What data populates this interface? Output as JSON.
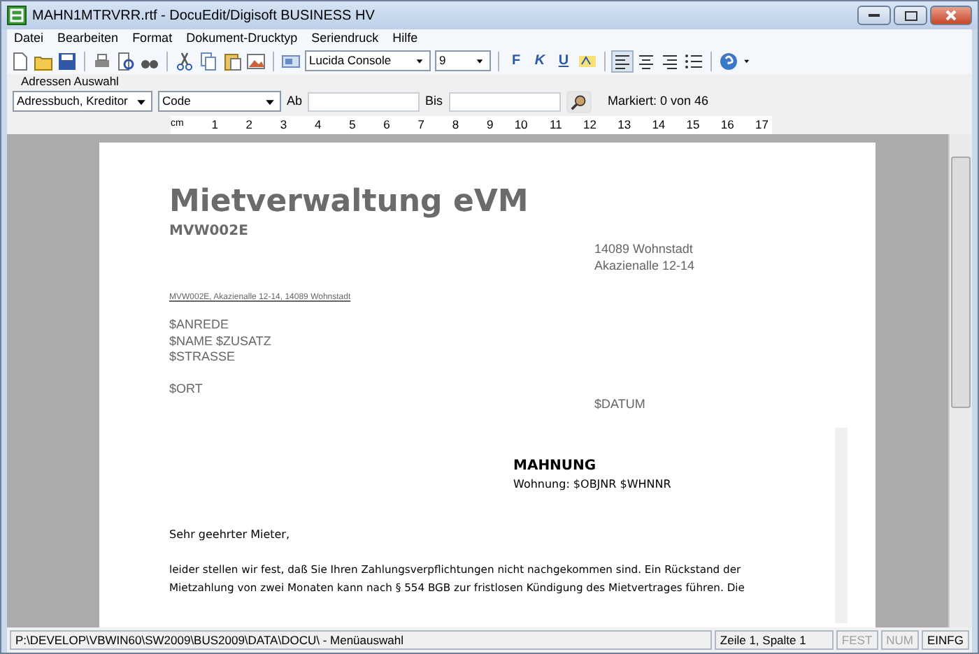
{
  "window": {
    "title": "MAHN1MTRVRR.rtf - DocuEdit/Digisoft BUSINESS HV"
  },
  "menu": [
    "Datei",
    "Bearbeiten",
    "Format",
    "Dokument-Drucktyp",
    "Seriendruck",
    "Hilfe"
  ],
  "toolbar": {
    "font": "Lucida Console",
    "size": "9",
    "format_buttons": [
      {
        "label": "F",
        "kind": "bold"
      },
      {
        "label": "K",
        "kind": "italic"
      },
      {
        "label": "U",
        "kind": "underline"
      }
    ],
    "align": [
      {
        "selected": true
      },
      {
        "selected": false
      },
      {
        "selected": false
      }
    ]
  },
  "address": {
    "label": "Adressen Auswahl",
    "source": "Adressbuch, Kreditor",
    "field": "Code",
    "from_label": "Ab",
    "to_label": "Bis",
    "marked": "Markiert: 0 von 46"
  },
  "ruler": {
    "unit": "cm",
    "ticks": [
      "1",
      "2",
      "3",
      "4",
      "5",
      "6",
      "7",
      "8",
      "9",
      "10",
      "11",
      "12",
      "13",
      "14",
      "15",
      "16",
      "17"
    ]
  },
  "document": {
    "title": "Mietverwaltung eVM",
    "code": "MVW002E",
    "sender": [
      "14089 Wohnstadt",
      "Akazienalle 12-14"
    ],
    "return_address": "MVW002E, Akazienalle 12-14, 14089 Wohnstadt",
    "recipient": [
      "$ANREDE",
      "$NAME $ZUSATZ",
      "$STRASSE"
    ],
    "place": "$ORT",
    "date": "$DATUM",
    "subject": "MAHNUNG",
    "subline": "Wohnung: $OBJNR $WHNNR",
    "salutation": "Sehr geehrter Mieter,",
    "body": [
      "leider stellen wir fest, daß Sie Ihren Zahlungsverpflichtungen nicht nachgekommen sind. Ein Rückstand der",
      "Mietzahlung von zwei Monaten kann nach § 554 BGB zur fristlosen Kündigung des Mietvertrages führen. Die"
    ]
  },
  "status_bar": {
    "path": "P:\\DEVELOP\\VBWIN60\\SW2009\\BUS2009\\DATA\\DOCU\\ - Menüauswahl",
    "position": "Zeile 1, Spalte 1",
    "indicators": [
      {
        "label": "FEST",
        "enabled": false
      },
      {
        "label": "NUM",
        "enabled": false
      },
      {
        "label": "EINFG",
        "enabled": true
      }
    ]
  }
}
